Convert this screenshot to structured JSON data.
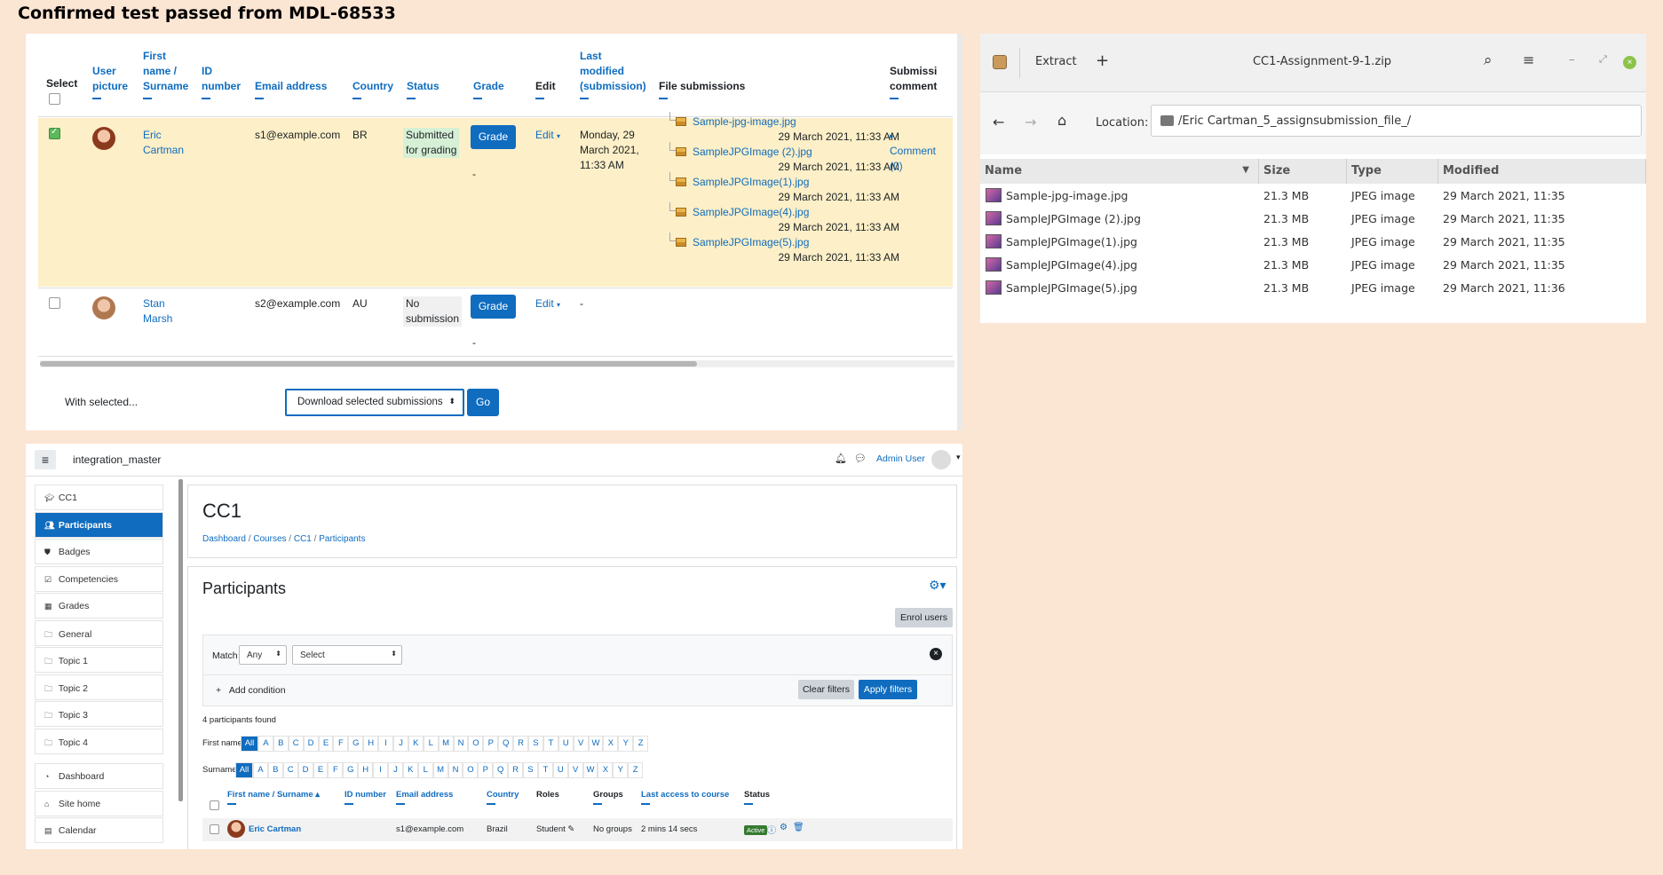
{
  "caption": "Confirmed test passed from MDL-68533",
  "grading_table": {
    "headers": {
      "select": "Select",
      "user_picture": [
        "User",
        "picture"
      ],
      "name": [
        "First",
        "name /",
        "Surname"
      ],
      "id_number": [
        "ID",
        "number"
      ],
      "email": "Email address",
      "country": "Country",
      "status": "Status",
      "grade": "Grade",
      "edit": "Edit",
      "last_modified": [
        "Last",
        "modified",
        "(submission)"
      ],
      "file_submissions": "File submissions",
      "submission_comments": [
        "Submissi",
        "comment"
      ]
    },
    "rows": [
      {
        "first": "Eric",
        "last": "Cartman",
        "email": "s1@example.com",
        "country": "BR",
        "status": [
          "Submitted",
          "for grading"
        ],
        "grade_button": "Grade",
        "grade_dash": "-",
        "edit": "Edit",
        "last_modified": [
          "Monday, 29",
          "March 2021,",
          "11:33 AM"
        ],
        "files": [
          {
            "name": "Sample-jpg-image.jpg",
            "time": "29 March 2021, 11:33 AM"
          },
          {
            "name": "SampleJPGImage (2).jpg",
            "time": "29 March 2021, 11:33 AM"
          },
          {
            "name": "SampleJPGImage(1).jpg",
            "time": "29 March 2021, 11:33 AM"
          },
          {
            "name": "SampleJPGImage(4).jpg",
            "time": "29 March 2021, 11:33 AM"
          },
          {
            "name": "SampleJPGImage(5).jpg",
            "time": "29 March 2021, 11:33 AM"
          }
        ],
        "comments": [
          "Comment",
          "(0)"
        ]
      },
      {
        "first": "Stan",
        "last": "Marsh",
        "email": "s2@example.com",
        "country": "AU",
        "status": [
          "No",
          "submission"
        ],
        "grade_button": "Grade",
        "grade_dash": "-",
        "edit": "Edit",
        "last_modified_dash": "-"
      }
    ],
    "with_selected": "With selected...",
    "bulk_action": "Download selected submissions",
    "go": "Go"
  },
  "archive": {
    "extract": "Extract",
    "plus": "+",
    "title": "CC1-Assignment-9-1.zip",
    "location_label": "Location:",
    "location_value": "/Eric Cartman_5_assignsubmission_file_/",
    "columns": [
      "Name",
      "Size",
      "Type",
      "Modified"
    ],
    "files": [
      {
        "name": "Sample-jpg-image.jpg",
        "size": "21.3 MB",
        "type": "JPEG image",
        "modified": "29 March 2021, 11:35"
      },
      {
        "name": "SampleJPGImage (2).jpg",
        "size": "21.3 MB",
        "type": "JPEG image",
        "modified": "29 March 2021, 11:35"
      },
      {
        "name": "SampleJPGImage(1).jpg",
        "size": "21.3 MB",
        "type": "JPEG image",
        "modified": "29 March 2021, 11:35"
      },
      {
        "name": "SampleJPGImage(4).jpg",
        "size": "21.3 MB",
        "type": "JPEG image",
        "modified": "29 March 2021, 11:35"
      },
      {
        "name": "SampleJPGImage(5).jpg",
        "size": "21.3 MB",
        "type": "JPEG image",
        "modified": "29 March 2021, 11:36"
      }
    ]
  },
  "moodle": {
    "site_name": "integration_master",
    "user": "Admin User",
    "sidebar": [
      "CC1",
      "Participants",
      "Badges",
      "Competencies",
      "Grades",
      "General",
      "Topic 1",
      "Topic 2",
      "Topic 3",
      "Topic 4",
      "Dashboard",
      "Site home",
      "Calendar"
    ],
    "course_title": "CC1",
    "breadcrumb": [
      "Dashboard",
      "Courses",
      "CC1",
      "Participants"
    ],
    "section_title": "Participants",
    "enrol_users": "Enrol users",
    "match_label": "Match",
    "match_value": "Any",
    "select_value": "Select",
    "add_condition": "Add condition",
    "clear_filters": "Clear filters",
    "apply_filters": "Apply filters",
    "found": "4 participants found",
    "first_name_label": "First name",
    "surname_label": "Surname",
    "all": "All",
    "letters": [
      "A",
      "B",
      "C",
      "D",
      "E",
      "F",
      "G",
      "H",
      "I",
      "J",
      "K",
      "L",
      "M",
      "N",
      "O",
      "P",
      "Q",
      "R",
      "S",
      "T",
      "U",
      "V",
      "W",
      "X",
      "Y",
      "Z"
    ],
    "columns": {
      "name": "First name / Surname",
      "id": "ID number",
      "email": "Email address",
      "country": "Country",
      "roles": "Roles",
      "groups": "Groups",
      "last_access": "Last access to course",
      "status": "Status"
    },
    "row": {
      "name": "Eric Cartman",
      "email": "s1@example.com",
      "country": "Brazil",
      "role": "Student",
      "groups": "No groups",
      "last_access": "2 mins 14 secs",
      "status": "Active"
    }
  }
}
